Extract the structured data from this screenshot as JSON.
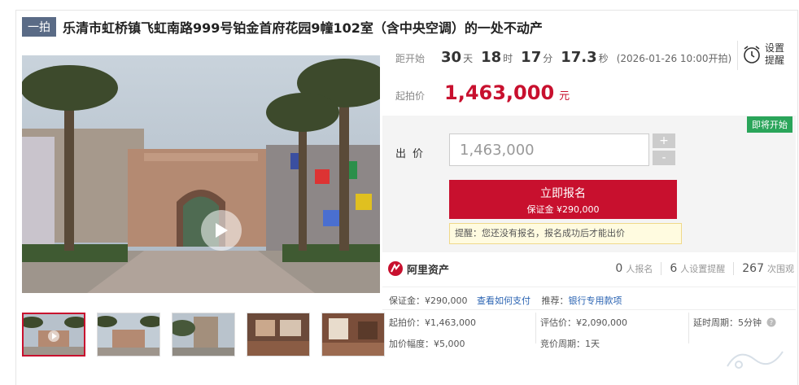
{
  "header": {
    "tag": "一拍",
    "title": "乐清市虹桥镇飞虹南路999号铂金首府花园9幢102室（含中央空调）的一处不动产"
  },
  "countdown": {
    "label": "距开始",
    "days": "30",
    "days_unit": "天",
    "hours": "18",
    "hours_unit": "时",
    "minutes": "17",
    "minutes_unit": "分",
    "seconds": "17.3",
    "seconds_unit": "秒",
    "start_time": "(2026-01-26 10:00开拍)"
  },
  "reminder": {
    "label": "设置提醒",
    "icon": "alarm-clock-icon"
  },
  "start_price": {
    "label": "起拍价",
    "value": "1,463,000",
    "unit": "元"
  },
  "bid": {
    "status_badge": "即将开始",
    "label": "出价",
    "value": "1,463,000",
    "plus": "+",
    "minus": "-",
    "apply_label": "立即报名",
    "deposit_sub": "保证金 ¥290,000",
    "tip": "提醒：您还没有报名，报名成功后才能出价"
  },
  "platform": {
    "name": "阿里资产",
    "icon": "ali-assets-logo-icon"
  },
  "stats": [
    {
      "value": "0",
      "label": "人报名"
    },
    {
      "value": "6",
      "label": "人设置提醒"
    },
    {
      "value": "267",
      "label": "次围观"
    }
  ],
  "details": {
    "deposit_label": "保证金：",
    "deposit_value": "¥290,000",
    "how_to_pay": "查看如何支付",
    "recommend_label": "推荐：",
    "recommend_value": "银行专用款项",
    "start_price_label": "起拍价：",
    "start_price_value": "¥1,463,000",
    "eval_label": "评估价：",
    "eval_value": "¥2,090,000",
    "delay_label": "延时周期：",
    "delay_value": "5分钟",
    "increment_label": "加价幅度：",
    "increment_value": "¥5,000",
    "cycle_label": "竞价周期：",
    "cycle_value": "1天"
  },
  "colors": {
    "accent": "#c8102e",
    "badge": "#2aa55a",
    "tag": "#5a6b86",
    "link": "#2a63b2"
  }
}
